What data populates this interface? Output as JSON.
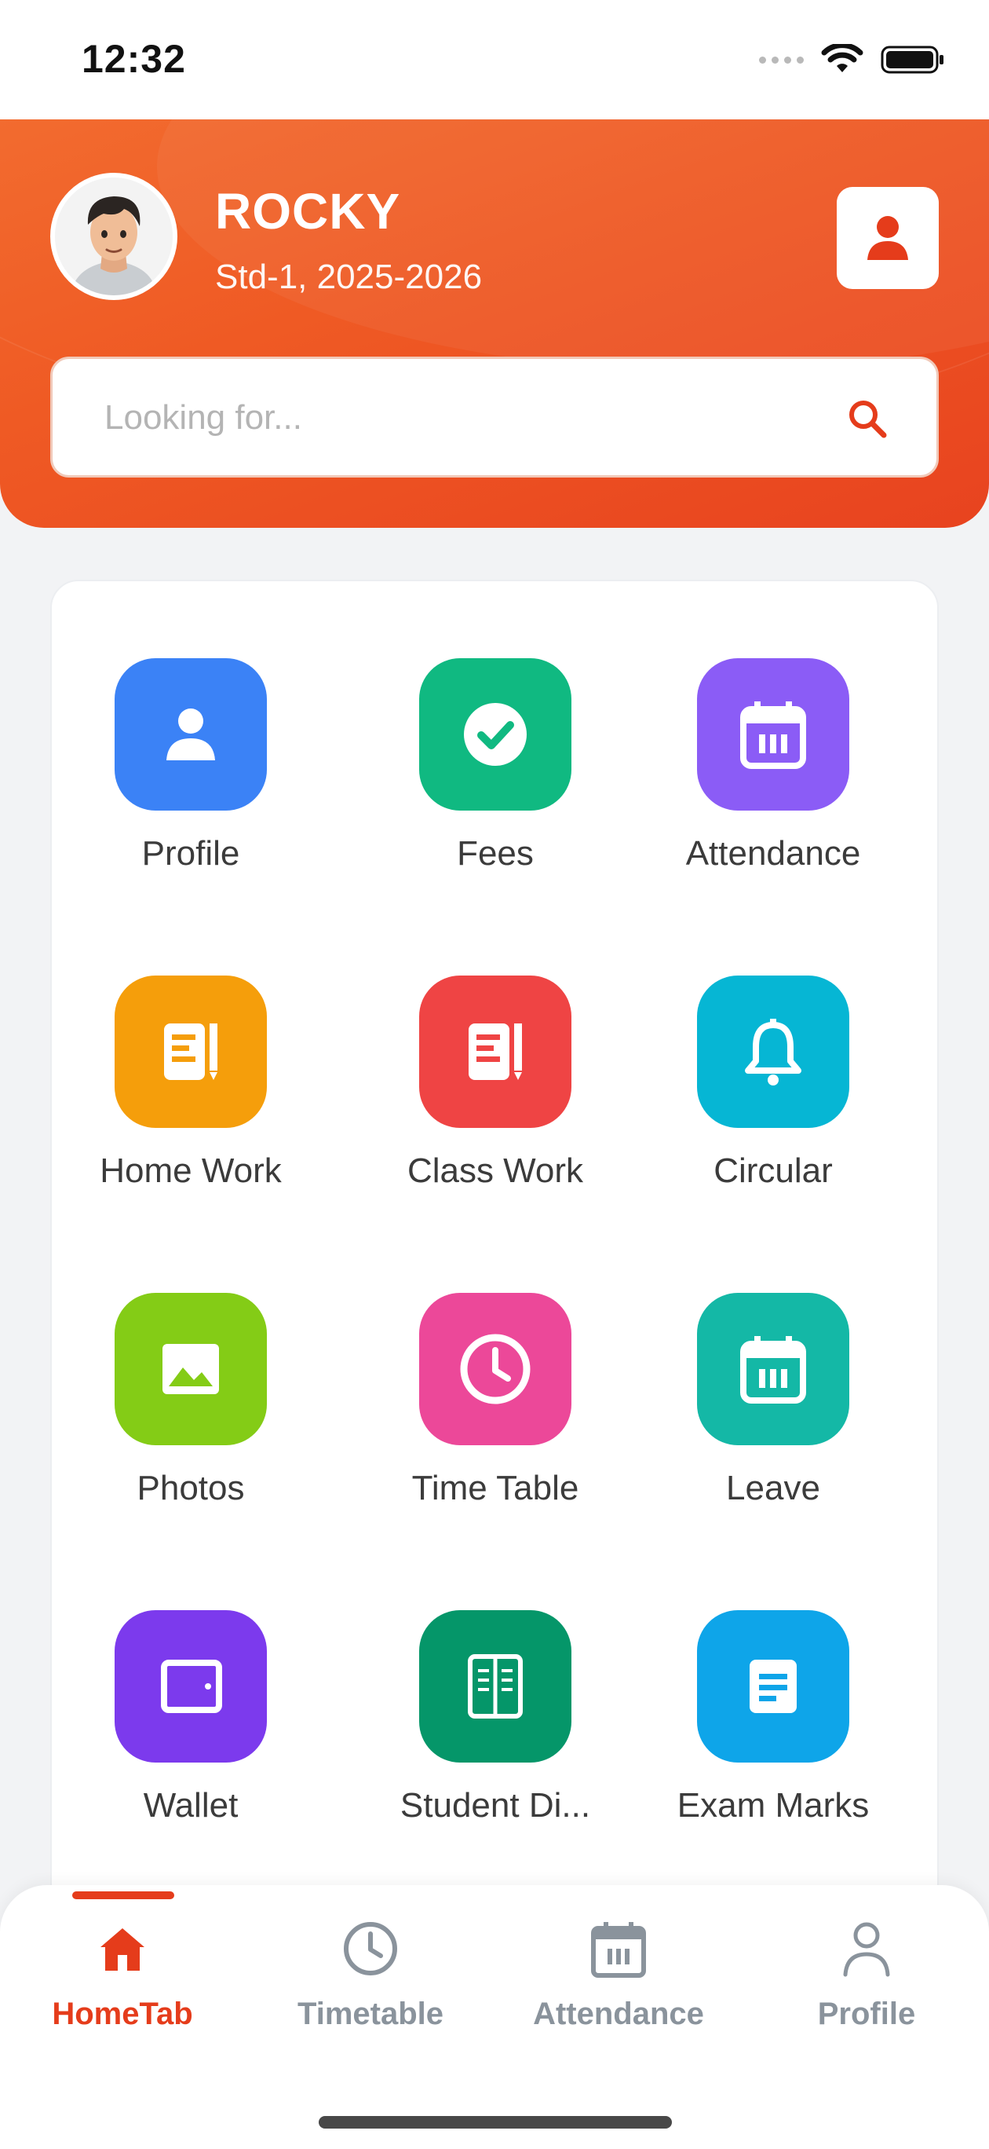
{
  "status_bar": {
    "time": "12:32"
  },
  "header": {
    "user_name": "ROCKY",
    "user_class": "Std-1, 2025-2026"
  },
  "search": {
    "placeholder": "Looking for..."
  },
  "tiles": [
    {
      "label": "Profile",
      "color": "#3b82f6",
      "icon": "user-icon"
    },
    {
      "label": "Fees",
      "color": "#10b981",
      "icon": "check-circle-icon"
    },
    {
      "label": "Attendance",
      "color": "#8b5cf6",
      "icon": "calendar-icon"
    },
    {
      "label": "Home Work",
      "color": "#f59e0b",
      "icon": "notebook-icon"
    },
    {
      "label": "Class Work",
      "color": "#ef4444",
      "icon": "notebook-icon"
    },
    {
      "label": "Circular",
      "color": "#06b6d4",
      "icon": "bell-icon"
    },
    {
      "label": "Photos",
      "color": "#84cc16",
      "icon": "image-icon"
    },
    {
      "label": "Time Table",
      "color": "#ec4899",
      "icon": "clock-icon"
    },
    {
      "label": "Leave",
      "color": "#14b8a6",
      "icon": "calendar-icon"
    },
    {
      "label": "Wallet",
      "color": "#7c3aed",
      "icon": "wallet-icon"
    },
    {
      "label": "Student Di...",
      "color": "#059669",
      "icon": "book-icon"
    },
    {
      "label": "Exam Marks",
      "color": "#0ea5e9",
      "icon": "document-icon"
    }
  ],
  "bottom_nav": {
    "active_color": "#e53c1b",
    "items": [
      {
        "label": "HomeTab",
        "icon": "home-icon",
        "active": true
      },
      {
        "label": "Timetable",
        "icon": "clock-icon",
        "active": false
      },
      {
        "label": "Attendance",
        "icon": "calendar-icon",
        "active": false
      },
      {
        "label": "Profile",
        "icon": "person-outline-icon",
        "active": false
      }
    ]
  }
}
